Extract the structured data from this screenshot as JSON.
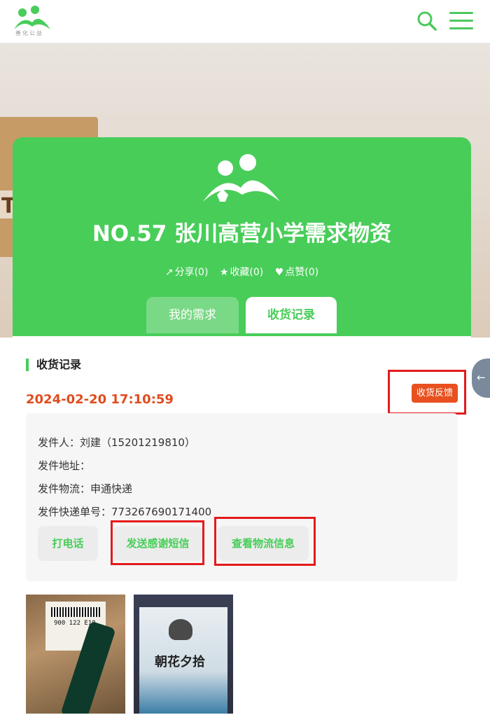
{
  "header": {
    "logo_text": "善化公益",
    "search_icon": "search-icon",
    "menu_icon": "hamburger-menu-icon"
  },
  "hero": {
    "title": "NO.57 张川高营小学需求物资",
    "actions": [
      {
        "icon": "share-icon",
        "label": "分享(0)"
      },
      {
        "icon": "star-icon",
        "label": "收藏(0)"
      },
      {
        "icon": "heart-icon",
        "label": "点赞(0)"
      }
    ],
    "tabs": [
      {
        "label": "我的需求",
        "active": false
      },
      {
        "label": "收货记录",
        "active": true
      }
    ]
  },
  "record": {
    "section_title": "收货记录",
    "datetime": "2024-02-20 17:10:59",
    "feedback_button": "收货反馈",
    "sender_label": "发件人：刘建（15201219810）",
    "address_label": "发件地址：",
    "logistics_label": "发件物流：申通快递",
    "tracking_label": "发件快递单号：773267690171400",
    "buttons": {
      "call": "打电话",
      "send_sms": "发送感谢短信",
      "view_logistics": "查看物流信息"
    },
    "photo1": {
      "number": "900 122 E10"
    },
    "photo2": {
      "book_title": "朝花夕拾"
    }
  },
  "colors": {
    "brand_green": "#48cd59",
    "date_orange": "#e04c1e",
    "feedback_bg": "#e8511f",
    "highlight_red": "#e41a1c"
  }
}
